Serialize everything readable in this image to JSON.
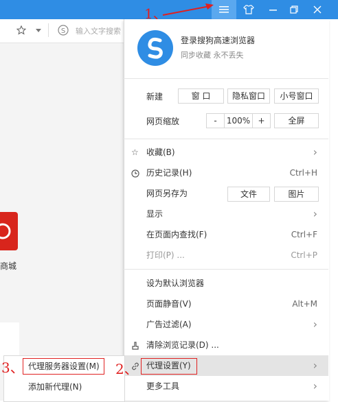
{
  "titlebar": {
    "accent": "#2f8de4",
    "buttons": [
      "menu-icon",
      "skin-icon",
      "minimize-icon",
      "restore-icon",
      "close-icon"
    ]
  },
  "annotations": {
    "step1": "1、",
    "step2": "2、",
    "step3": "3、"
  },
  "addressbar": {
    "placeholder": "输入文字搜索"
  },
  "left": {
    "shop_label": "商城"
  },
  "account": {
    "title": "登录搜狗高速浏览器",
    "subtitle": "同步收藏 永不丢失"
  },
  "new_row": {
    "label": "新建",
    "window": "窗 口",
    "private": "隐私窗口",
    "small": "小号窗口"
  },
  "zoom_row": {
    "label": "网页缩放",
    "minus": "-",
    "value": "100%",
    "plus": "+",
    "fullscreen": "全屏"
  },
  "menu": {
    "favorites": "收藏(B)",
    "history": "历史记录(H)",
    "history_sc": "Ctrl+H",
    "saveas": "网页另存为",
    "saveas_file": "文件",
    "saveas_image": "图片",
    "display": "显示",
    "find": "在页面内查找(F)",
    "find_sc": "Ctrl+F",
    "print": "打印(P) ...",
    "print_sc": "Ctrl+P",
    "default": "设为默认浏览器",
    "mute": "页面静音(V)",
    "mute_sc": "Alt+M",
    "adfilter": "广告过滤(A)",
    "clear": "清除浏览记录(D) ...",
    "proxy": "代理设置(Y)",
    "moretools": "更多工具"
  },
  "submenu": {
    "server": "代理服务器设置(M)",
    "add": "添加新代理(N)"
  }
}
